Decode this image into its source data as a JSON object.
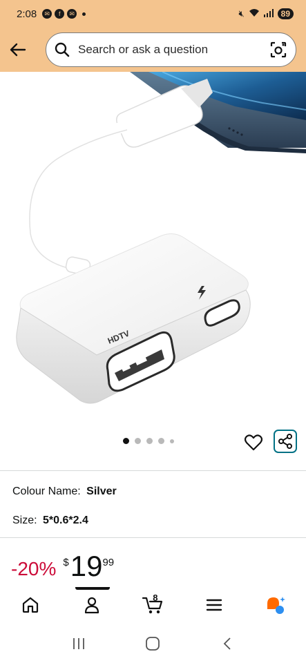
{
  "status_bar": {
    "time": "2:08",
    "battery": "89"
  },
  "search": {
    "placeholder": "Search or ask a question"
  },
  "product_image": {
    "label": "HDTV"
  },
  "carousel": {
    "dots": 5,
    "active_index": 0
  },
  "attributes": {
    "colour_label": "Colour Name:",
    "colour_value": "Silver",
    "size_label": "Size:",
    "size_value": "5*0.6*2.4"
  },
  "price": {
    "discount": "-20%",
    "symbol": "$",
    "whole": "19",
    "fraction": "99"
  },
  "bottom_nav": {
    "cart_count": "8",
    "items": [
      "home-icon",
      "account-icon",
      "cart-icon",
      "menu-icon",
      "rufus-icon"
    ]
  },
  "colors": {
    "header_bg": "#f4c48e",
    "discount": "#cc0c39",
    "share_border": "#007185",
    "rufus_orange": "#ff6a00",
    "rufus_blue": "#2d8ff0"
  }
}
